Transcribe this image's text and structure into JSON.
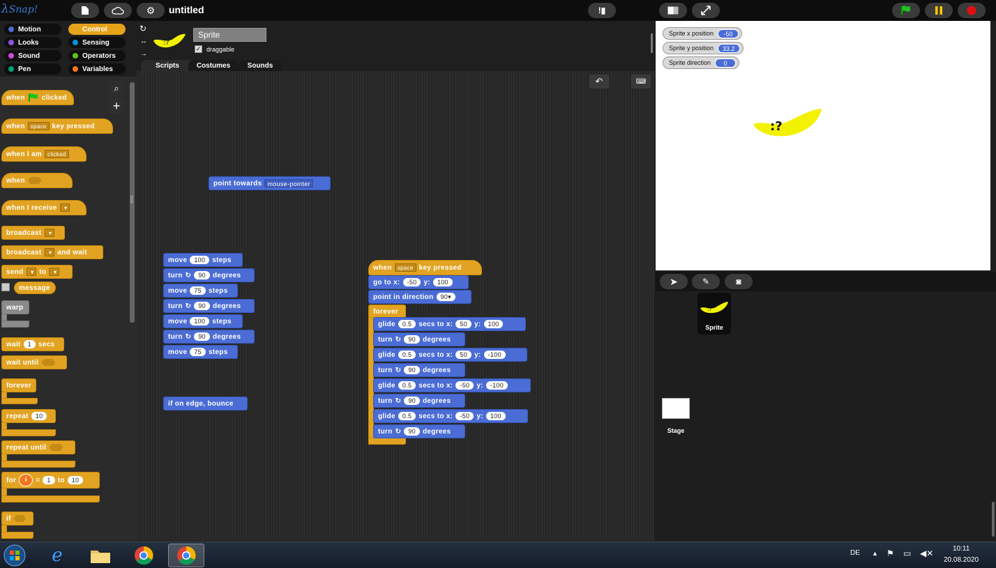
{
  "topbar": {
    "logo": "Snap!",
    "project_title": "untitled"
  },
  "categories": [
    {
      "label": "Motion",
      "color": "#4a6cd4"
    },
    {
      "label": "Control",
      "color": "#e1a321",
      "active": true
    },
    {
      "label": "Looks",
      "color": "#8f56e3"
    },
    {
      "label": "Sensing",
      "color": "#0494dc"
    },
    {
      "label": "Sound",
      "color": "#cf4ad9"
    },
    {
      "label": "Operators",
      "color": "#62c213"
    },
    {
      "label": "Pen",
      "color": "#00a178"
    },
    {
      "label": "Variables",
      "color": "#f3761d"
    }
  ],
  "palette": {
    "when_flag": {
      "pre": "when",
      "post": "clicked"
    },
    "when_key": {
      "pre": "when",
      "dd": "space",
      "post": "key pressed"
    },
    "when_i_am": {
      "pre": "when I am",
      "dd": "clicked"
    },
    "when_cond": {
      "pre": "when"
    },
    "when_receive": {
      "pre": "when I receive"
    },
    "broadcast": {
      "pre": "broadcast"
    },
    "broadcast_wait": {
      "pre": "broadcast",
      "post": "and wait"
    },
    "send": {
      "pre": "send",
      "mid": "to"
    },
    "message": "message",
    "warp": "warp",
    "wait": {
      "pre": "wait",
      "val": "1",
      "post": "secs"
    },
    "wait_until": "wait until",
    "forever": "forever",
    "repeat": {
      "pre": "repeat",
      "val": "10"
    },
    "repeat_until": "repeat until",
    "for": {
      "pre": "for",
      "var": "i",
      "eq": "=",
      "from": "1",
      "to_label": "to",
      "to": "10"
    },
    "if": "if"
  },
  "sprite": {
    "name": "Sprite",
    "draggable_label": "draggable",
    "draggable": true
  },
  "tabs": [
    "Scripts",
    "Costumes",
    "Sounds"
  ],
  "scripts": {
    "point_towards": {
      "label": "point towards",
      "dd": "mouse-pointer"
    },
    "moves": [
      {
        "a": "move",
        "v": "100",
        "b": "steps"
      },
      {
        "a": "turn",
        "v": "90",
        "b": "degrees"
      },
      {
        "a": "move",
        "v": "75",
        "b": "steps"
      },
      {
        "a": "turn",
        "v": "90",
        "b": "degrees"
      },
      {
        "a": "move",
        "v": "100",
        "b": "steps"
      },
      {
        "a": "turn",
        "v": "90",
        "b": "degrees"
      },
      {
        "a": "move",
        "v": "75",
        "b": "steps"
      }
    ],
    "bounce": "if on edge, bounce",
    "main": {
      "hat": {
        "pre": "when",
        "dd": "space",
        "post": "key pressed"
      },
      "goto": {
        "a": "go to x:",
        "x": "-50",
        "b": "y:",
        "y": "100"
      },
      "point_dir": {
        "a": "point in direction",
        "v": "90"
      },
      "forever": "forever",
      "body": [
        {
          "kind": "glide",
          "secs": "0.5",
          "x": "50",
          "y": "100"
        },
        {
          "kind": "turn",
          "v": "90"
        },
        {
          "kind": "glide",
          "secs": "0.5",
          "x": "50",
          "y": "-100"
        },
        {
          "kind": "turn",
          "v": "90"
        },
        {
          "kind": "glide",
          "secs": "0.5",
          "x": "-50",
          "y": "-100"
        },
        {
          "kind": "turn",
          "v": "90"
        },
        {
          "kind": "glide",
          "secs": "0.5",
          "x": "-50",
          "y": "100"
        },
        {
          "kind": "turn",
          "v": "90"
        }
      ],
      "labels": {
        "glide": "glide",
        "secs": "secs to x:",
        "y": "y:",
        "turn": "turn",
        "degrees": "degrees"
      }
    }
  },
  "watchers": [
    {
      "label": "Sprite x position",
      "value": "-50"
    },
    {
      "label": "Sprite y position",
      "value": "33.2"
    },
    {
      "label": "Sprite direction",
      "value": "0"
    }
  ],
  "corral": {
    "sprite_label": "Sprite",
    "stage_label": "Stage"
  },
  "taskbar": {
    "lang": "DE",
    "time": "10:11",
    "date": "20.08.2020"
  }
}
